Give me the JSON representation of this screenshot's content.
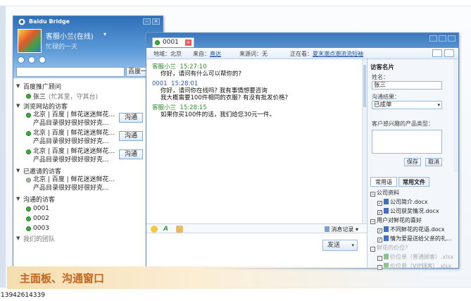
{
  "main_panel": {
    "app_title": "Baidu Bridge",
    "user_name": "客服小兰(在线)",
    "signature": "忙碌的一天",
    "search_button": "百度一",
    "groups": [
      {
        "label": "百度推广顾问"
      },
      {
        "label": "浏览网站的访客"
      },
      {
        "label": "已邀请的访客"
      },
      {
        "label": "沟通的访客"
      },
      {
        "label": "我们的团队"
      }
    ],
    "advisor": {
      "name": "张三",
      "status": "(忙其里，守其台)"
    },
    "visitors_browsing": [
      {
        "line1": "北京 | 百度 | 鲜花迷迷鲜花...",
        "line2": "产品目录很好很好很好克...",
        "button": "沟通"
      },
      {
        "line1": "北京 | 百度 | 鲜花迷迷鲜花...",
        "line2": "产品目录很好很好很好克...",
        "button": "沟通"
      },
      {
        "line1": "北京 | 百度 | 鲜花迷迷鲜花...",
        "line2": "产品目录很好很好很好克...",
        "button": "沟通"
      }
    ],
    "visitor_invited": {
      "line1": "北京 | 百度 | 鲜花迷迷鲜花...",
      "line2": "产品目录很好很好很好克..."
    },
    "communicated": [
      "0001",
      "0002",
      "0003"
    ]
  },
  "chat_window": {
    "tab_label": "0001",
    "info": {
      "region": "地域：北京",
      "source_label": "来自：",
      "source_link": "直达",
      "keyword": "来源词：无",
      "viewing_label": "正在看：",
      "viewing_link": "夏末潮点潮流流短袖"
    },
    "messages": [
      {
        "sender": "客服小兰",
        "time": "15:27:10",
        "lines": [
          "你好，请问有什么可以帮你的?"
        ]
      },
      {
        "sender": "0001",
        "time": "15:28:01",
        "lines": [
          "你好，请问你在线吗? 我有事情想要咨询",
          "我大概需要100件相同的衣服? 有没有批发价格?"
        ]
      },
      {
        "sender": "客服小兰",
        "time": "15:28:15",
        "lines": [
          "如果你买100件的话，我们给您30元一件。"
        ]
      }
    ],
    "message_record": "消息记录",
    "send_button": "发送"
  },
  "visitor_card": {
    "title": "访客名片",
    "name_label": "姓名：",
    "name_value": "张三",
    "result_label": "沟通结果：",
    "result_value": "已成单",
    "interest_label": "客户感兴趣的产品类型：",
    "save_button": "保存",
    "cancel_button": "取消"
  },
  "file_panel": {
    "tabs": [
      "常用语",
      "常用文件"
    ],
    "items": [
      {
        "type": "group",
        "label": "公司资料",
        "faded": false
      },
      {
        "type": "file",
        "label": "公司简介.docx",
        "faded": false
      },
      {
        "type": "file",
        "label": "公司获奖情况.docx",
        "faded": false
      },
      {
        "type": "group",
        "label": "用户对鲜花的喜好",
        "faded": false
      },
      {
        "type": "file",
        "label": "不同鲜花的花语.docx",
        "faded": false
      },
      {
        "type": "file",
        "label": "情为爱是送给父亲的礼...",
        "faded": false
      },
      {
        "type": "group",
        "label": "鲜花的价位?",
        "faded": true
      },
      {
        "type": "file",
        "label": "价位单（普通顾客）.xlsx",
        "faded": true
      },
      {
        "type": "file",
        "label": "价位单（VIP顾客）.xlsx",
        "faded": true
      }
    ]
  },
  "caption": "主面板、沟通窗口",
  "footer_number": "13942614339",
  "colors": {
    "title_blue": "#3b78bd",
    "online_green": "#3ab03a",
    "caption_orange": "#c4631c"
  }
}
